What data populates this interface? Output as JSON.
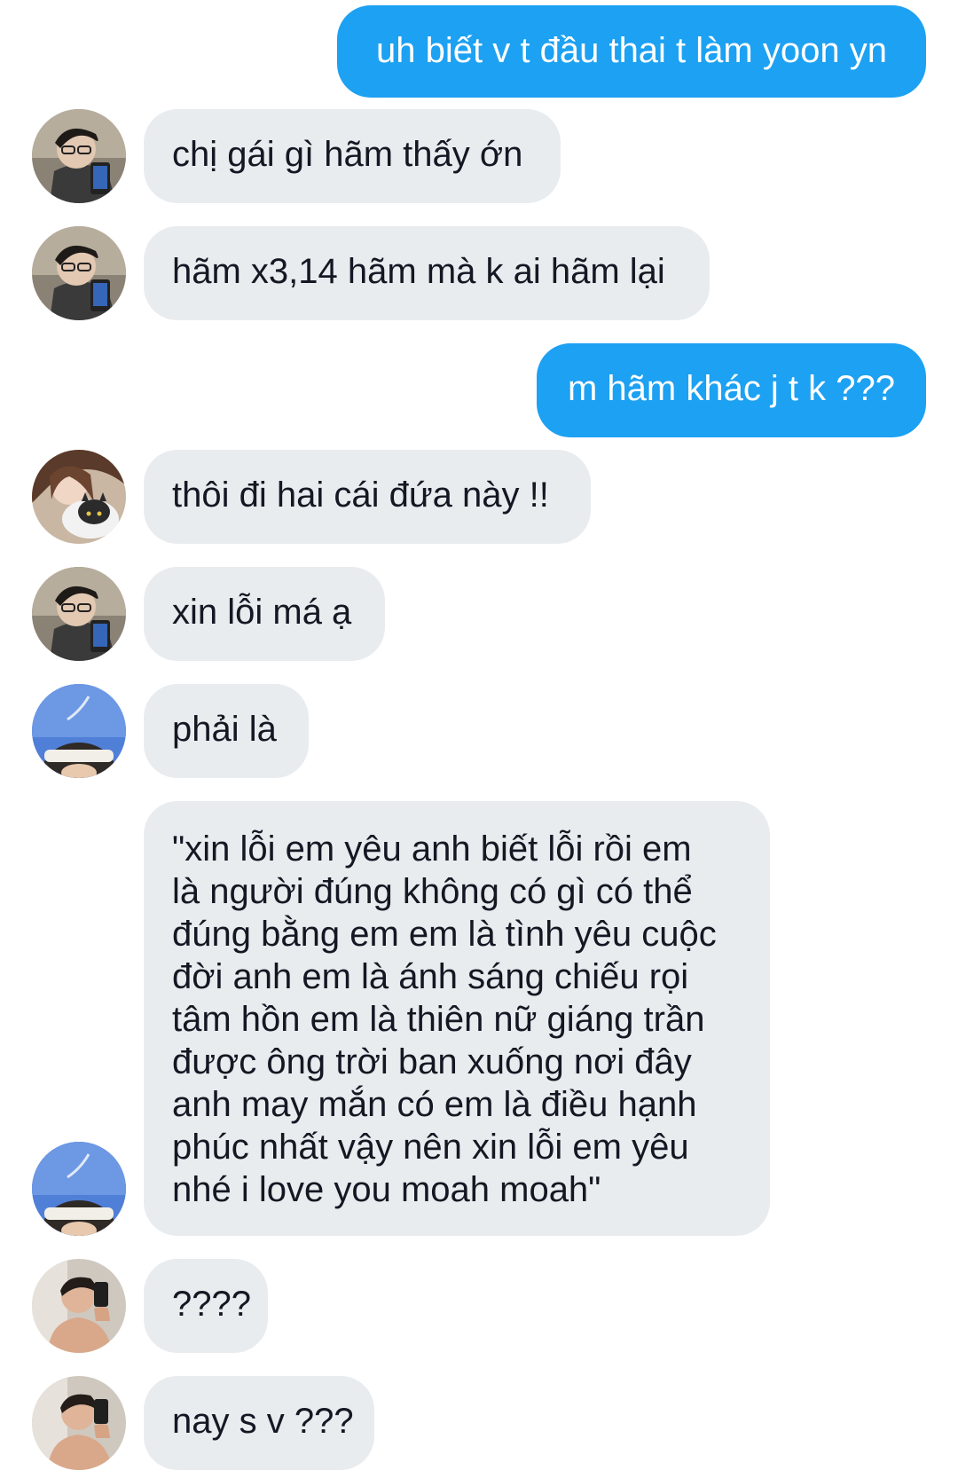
{
  "conversation": {
    "messages": [
      {
        "id": "m1",
        "side": "sent",
        "text": "uh biết v t đầu thai t làm yoon yn"
      },
      {
        "id": "m2",
        "side": "received",
        "avatar": "avatar-boy-glasses-icon",
        "text": "chị gái gì hãm thấy ớn"
      },
      {
        "id": "m3",
        "side": "received",
        "avatar": "avatar-boy-glasses-icon",
        "text": "hãm x3,14 hãm mà k ai hãm lại"
      },
      {
        "id": "m4",
        "side": "sent",
        "text": "m hãm khác j t k ???"
      },
      {
        "id": "m5",
        "side": "received",
        "avatar": "avatar-girl-cat-icon",
        "text": "thôi đi hai cái đứa này !!"
      },
      {
        "id": "m6",
        "side": "received",
        "avatar": "avatar-boy-glasses-icon",
        "text": "xin lỗi má ạ"
      },
      {
        "id": "m7",
        "side": "received",
        "avatar": "avatar-sky-headband-icon",
        "text": "phải là"
      },
      {
        "id": "m8",
        "side": "received",
        "avatar": "avatar-sky-headband-icon",
        "lines": [
          "\"xin lỗi em yêu anh biết lỗi rồi em",
          "là người đúng không có gì có thể",
          "đúng bằng em em là tình yêu cuộc",
          "đời anh em là ánh sáng chiếu rọi",
          "tâm hồn em là thiên nữ giáng trần",
          "được ông trời ban xuống nơi đây",
          "anh may mắn có em là điều hạnh",
          "phúc nhất vậy nên xin lỗi em yêu",
          "nhé i love you moah moah\""
        ]
      },
      {
        "id": "m9",
        "side": "received",
        "avatar": "avatar-mirror-selfie-icon",
        "text": "????"
      },
      {
        "id": "m10",
        "side": "received",
        "avatar": "avatar-mirror-selfie-icon",
        "text": "nay s v ???"
      }
    ]
  },
  "colors": {
    "sent_bubble": "#1da1f2",
    "received_bubble": "#e9ecef",
    "received_text": "#141823",
    "sent_text": "#ffffff"
  }
}
